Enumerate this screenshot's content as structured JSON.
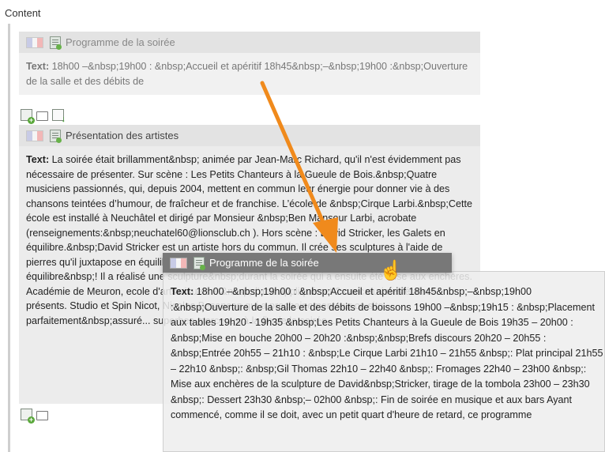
{
  "section": {
    "label": "Content"
  },
  "blocks": [
    {
      "title": "Programme de la soirée",
      "text_label": "Text:",
      "text": " 18h00 –&nbsp;19h00 : &nbsp;Accueil et apéritif 18h45&nbsp;–&nbsp;19h00 :&nbsp;Ouverture de la salle et des débits de"
    },
    {
      "title": "Présentation des artistes",
      "text_label": "Text:",
      "text": " La soirée était brillamment&nbsp; animée par Jean-Marc Richard, qu'il n'est évidemment pas nécessaire de présenter. Sur scène : Les Petits Chanteurs à la Gueule de Bois.&nbsp;Quatre musiciens passionnés, qui, depuis 2004, mettent en commun leur énergie pour donner vie à des chansons teintées d’humour, de fraîcheur et de franchise. L’école de &nbsp;Cirque Larbi.&nbsp;Cette école est installé à Neuchâtel et dirigé par Monsieur &nbsp;Ben Mansour Larbi, acrobate (renseignements:&nbsp;neuchatel60@lionsclub.ch ). Hors scène : David Stricker, les Galets en équilibre.&nbsp;David Stricker est un artiste hors du commun. Il crée ses sculptures à l'aide de pierres qu'il juxtapose en équilibre. Ses oeuvres sont fascinantes puisqu'elles tiennent en équilibre&nbsp;! Il a réalisé une sculpture&nbsp;durant la soirée qui a ensuite été mise aux enchères. Académie de Meuron, ecole d'arts visuels et&nbsp;d'arts appliqués et 2 caricaturistes étaient présents. Studio et Spin Nicot, Nicolas Besancon qui a prochainement sur ce site... parfaitement&nbsp;assuré... superbes morceaux à la fin de la soirée..."
    }
  ],
  "dragged_block": {
    "title": "Programme de la soirée",
    "text_label": "Text:",
    "text": " 18h00 –&nbsp;19h00 : &nbsp;Accueil et apéritif 18h45&nbsp;–&nbsp;19h00 :&nbsp;Ouverture de la salle et des débits de boissons 19h00 –&nbsp;19h15 : &nbsp;Placement aux tables 19h20 - 19h35 &nbsp;Les Petits Chanteurs à la Gueule de Bois 19h35 – 20h00 : &nbsp;Mise en bouche 20h00 – 20h20 :&nbsp;&nbsp;Brefs discours 20h20 – 20h55 : &nbsp;Entrée 20h55 – 21h10 : &nbsp;Le Cirque Larbi 21h10 – 21h55 &nbsp;: Plat principal 21h55 – 22h10 &nbsp;: &nbsp;Gil Thomas 22h10 – 22h40 &nbsp;: Fromages 22h40 – 23h00 &nbsp;: Mise aux enchères de la sculpture de David&nbsp;Stricker, tirage de la tombola 23h00 – 23h30 &nbsp;: Dessert 23h30 &nbsp;– 02h00 &nbsp;: Fin de soirée en musique et aux bars Ayant commencé, comme il se doit, avec un petit quart d'heure de retard, ce programme"
  },
  "toolbar_icons": [
    "add-content-icon",
    "folder-icon",
    "paste-icon"
  ],
  "colors": {
    "arrow": "#f08a1c",
    "header_bg": "#e3e3e3",
    "drag_header_bg": "#787878"
  }
}
